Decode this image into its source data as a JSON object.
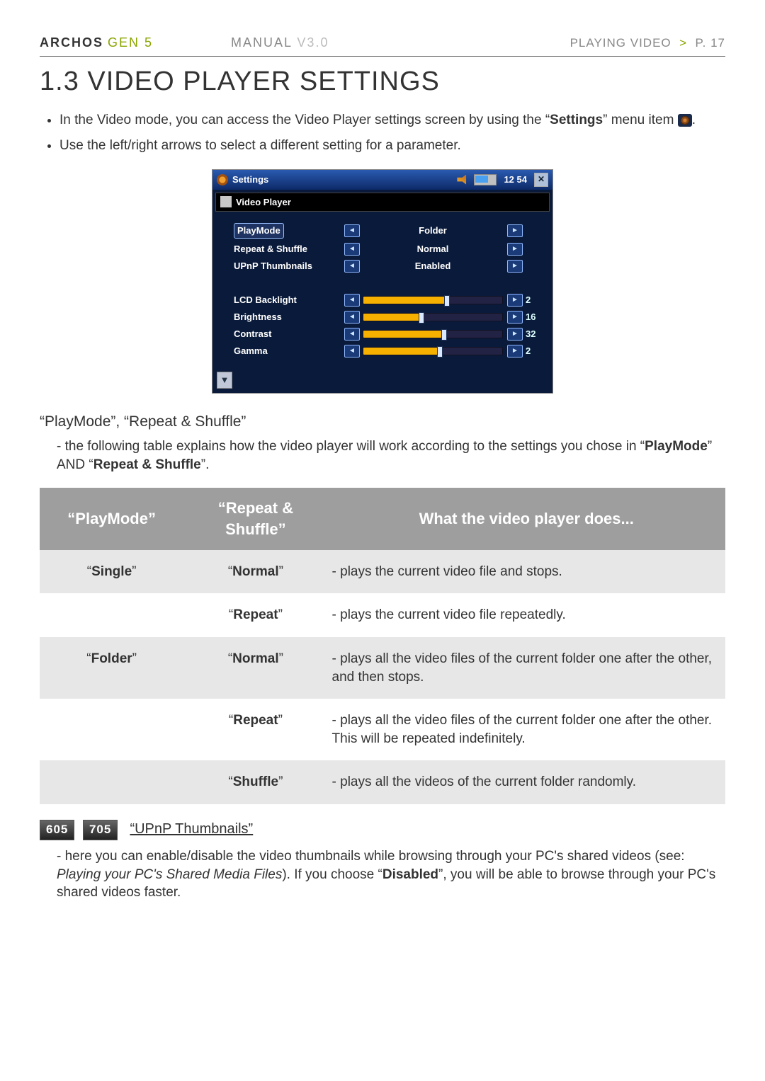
{
  "header": {
    "brand": "ARCHOS",
    "gen": "GEN 5",
    "manual": "MANUAL",
    "manual_ver": "V3.0",
    "crumb_section": "PLAYING VIDEO",
    "crumb_sep": ">",
    "crumb_page": "P. 17"
  },
  "title": "1.3  VIDEO PLAYER SETTINGS",
  "intro": {
    "line1a": "In the Video mode, you can access the Video Player settings screen by using the “",
    "line1b_bold": "Settings",
    "line1c": "” menu item ",
    "line1d": ".",
    "line2": "Use the left/right arrows to select a different setting for a parameter."
  },
  "device": {
    "title": "Settings",
    "clock": "12 54",
    "close": "✕",
    "sub": "Video Player",
    "rows_enum": [
      {
        "label": "PlayMode",
        "value": "Folder",
        "selected": true
      },
      {
        "label": "Repeat & Shuffle",
        "value": "Normal"
      },
      {
        "label": "UPnP Thumbnails",
        "value": "Enabled"
      }
    ],
    "rows_slider": [
      {
        "label": "LCD Backlight",
        "value": "2",
        "pct": 60
      },
      {
        "label": "Brightness",
        "value": "16",
        "pct": 42
      },
      {
        "label": "Contrast",
        "value": "32",
        "pct": 58
      },
      {
        "label": "Gamma",
        "value": "2",
        "pct": 55
      }
    ]
  },
  "sub1": "“PlayMode”, “Repeat & Shuffle”",
  "sub1_para_a": "the following table explains how the video player will work according to the settings you chose in “",
  "sub1_para_b": "PlayMode",
  "sub1_para_c": "” AND “",
  "sub1_para_d": "Repeat & Shuffle",
  "sub1_para_e": "”.",
  "table": {
    "th1": "“PlayMode”",
    "th2": "“Repeat & Shuffle”",
    "th3": "What the video player does...",
    "rows": [
      {
        "pm": "Single",
        "rs": "Normal",
        "desc": "- plays the current video file and stops.",
        "band": true
      },
      {
        "pm": "",
        "rs": "Repeat",
        "desc": "- plays the current video file repeatedly."
      },
      {
        "pm": "Folder",
        "rs": "Normal",
        "desc": "- plays all the video files of the current folder one after the other, and then stops.",
        "band": true
      },
      {
        "pm": "",
        "rs": "Repeat",
        "desc": "- plays all the video files of the current folder one after the other. This will be repeated indefinitely."
      },
      {
        "pm": "",
        "rs": "Shuffle",
        "desc": "- plays all the videos of the current folder randomly.",
        "band": true
      }
    ]
  },
  "badges": {
    "a": "605",
    "b": "705"
  },
  "upnp_title": "“UPnP Thumbnails”",
  "upnp_para_a": "here you can enable/disable the video thumbnails while browsing through your PC's shared videos (see: ",
  "upnp_para_i": "Playing your PC's Shared Media Files",
  "upnp_para_b": "). If you choose “",
  "upnp_para_bold": "Disabled",
  "upnp_para_c": "”, you will be able to browse through your PC's shared videos faster."
}
